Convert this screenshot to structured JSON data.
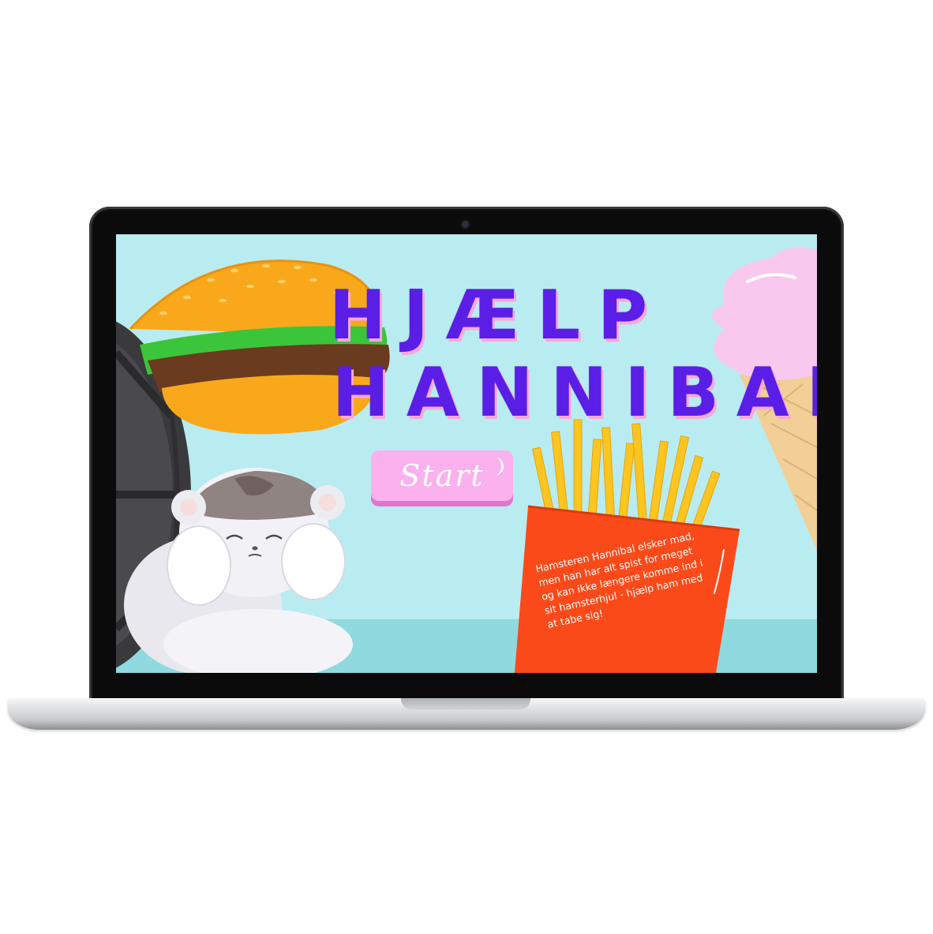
{
  "game": {
    "title_line1": "HJÆLP",
    "title_line2": "HANNIBAL",
    "start_label": "Start",
    "story_text": "Hamsteren Hannibal elsker mad, men han har alt spist for meget og kan ikke længere komme ind i sit hamsterhjul - hjælp ham med at tabe sig!"
  },
  "colors": {
    "sky": "#b9ecf1",
    "floor": "#8fd9df",
    "title": "#5b1ee6",
    "title_shadow": "#f7a8d9",
    "button": "#fbb1ee",
    "fries_box": "#fb4a1a",
    "fries": "#fcc520"
  },
  "icons": {
    "burger": "burger-icon",
    "ice_cream": "ice-cream-icon",
    "fries": "fries-icon",
    "wheel": "hamster-wheel-icon",
    "hamster": "hamster-character-icon"
  }
}
